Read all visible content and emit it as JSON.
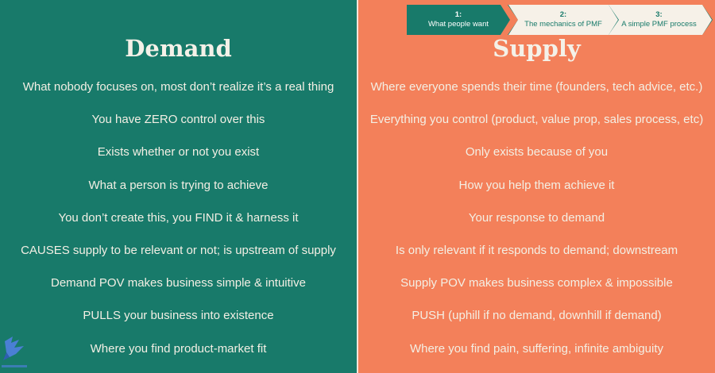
{
  "stepper": {
    "steps": [
      {
        "num": "1:",
        "label": "What people want"
      },
      {
        "num": "2:",
        "label": "The mechanics of PMF"
      },
      {
        "num": "3:",
        "label": "A simple PMF process"
      }
    ]
  },
  "demand": {
    "heading": "Demand",
    "rows": [
      "What nobody focuses on, most don’t realize it’s a real thing",
      "You have ZERO control over this",
      "Exists whether or not you exist",
      "What a person is trying to achieve",
      "You don’t create this, you FIND it & harness it",
      "CAUSES supply to be relevant or not; is upstream of supply",
      "Demand POV makes business simple & intuitive",
      "PULLS your business into existence",
      "Where you find product-market fit"
    ]
  },
  "supply": {
    "heading": "Supply",
    "rows": [
      "Where everyone spends their time (founders, tech advice, etc.)",
      "Everything you control (product, value prop, sales process, etc)",
      "Only exists because of you",
      "How you help them achieve it",
      "Your response to demand",
      "Is only relevant if it responds to demand; downstream",
      "Supply POV makes business complex & impossible",
      "PUSH (uphill if no demand, downhill if demand)",
      "Where you find pain, suffering, infinite ambiguity"
    ]
  },
  "colors": {
    "demand_bg": "#187a6a",
    "supply_bg": "#f3805a",
    "text": "#f3efe4"
  },
  "logo_icon": "bird-logo-icon"
}
